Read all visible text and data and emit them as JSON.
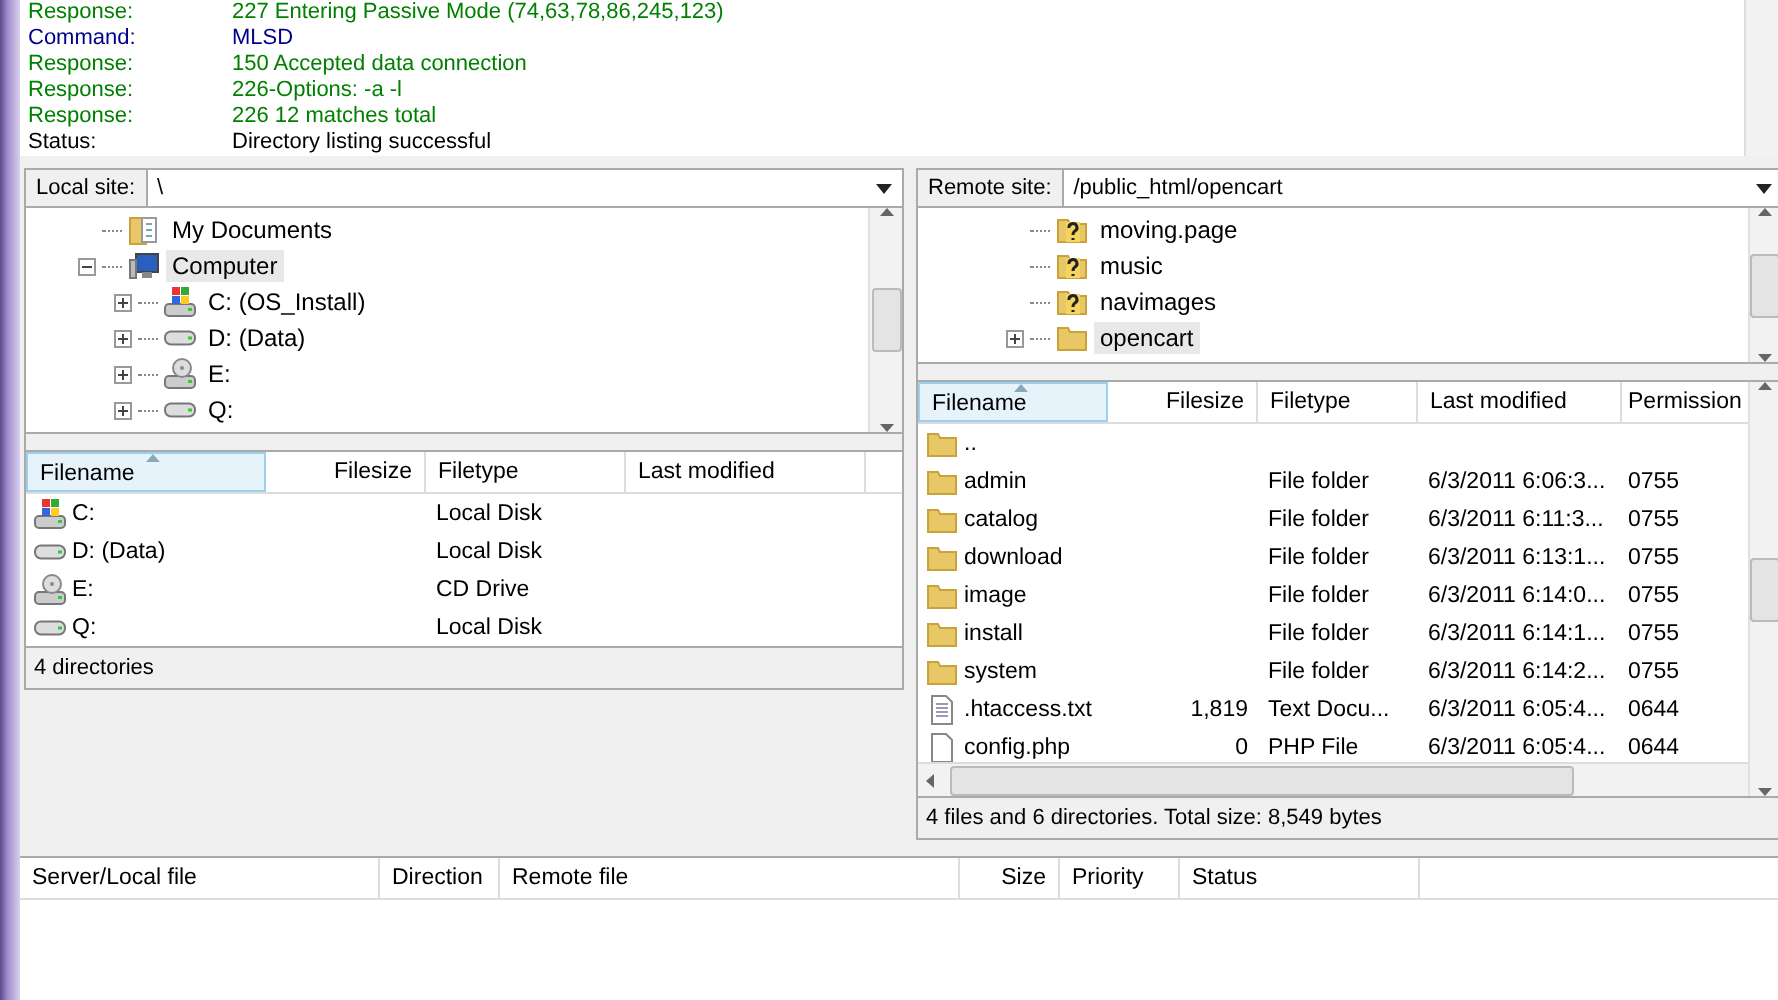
{
  "log": [
    {
      "kind": "response",
      "label": "Response:",
      "text": "227 Entering Passive Mode (74,63,78,86,245,123)"
    },
    {
      "kind": "command",
      "label": "Command:",
      "text": "MLSD"
    },
    {
      "kind": "response",
      "label": "Response:",
      "text": "150 Accepted data connection"
    },
    {
      "kind": "response",
      "label": "Response:",
      "text": "226-Options: -a -l"
    },
    {
      "kind": "response",
      "label": "Response:",
      "text": "226 12 matches total"
    },
    {
      "kind": "status",
      "label": "Status:",
      "text": "Directory listing successful"
    }
  ],
  "local": {
    "site_label": "Local site:",
    "path": "\\",
    "tree": [
      {
        "kind": "documents",
        "label": "My Documents",
        "selected": false
      },
      {
        "kind": "computer",
        "label": "Computer",
        "selected": true,
        "expanded": true,
        "children": [
          {
            "kind": "drive_windows",
            "label": "C: (OS_Install)",
            "selected": false,
            "expanded": false
          },
          {
            "kind": "drive",
            "label": "D: (Data)",
            "selected": false,
            "expanded": false
          },
          {
            "kind": "drive_cd",
            "label": "E:",
            "selected": false,
            "expanded": false
          },
          {
            "kind": "drive",
            "label": "Q:",
            "selected": false,
            "expanded": false
          }
        ]
      }
    ],
    "columns": [
      {
        "label": "Filename",
        "sorted": true
      },
      {
        "label": "Filesize",
        "sorted": false
      },
      {
        "label": "Filetype",
        "sorted": false
      },
      {
        "label": "Last modified",
        "sorted": false
      }
    ],
    "rows": [
      {
        "kind": "drive_windows",
        "name": "C:",
        "type": "Local Disk"
      },
      {
        "kind": "drive",
        "name": "D: (Data)",
        "type": "Local Disk"
      },
      {
        "kind": "drive_cd",
        "name": "E:",
        "type": "CD Drive"
      },
      {
        "kind": "drive",
        "name": "Q:",
        "type": "Local Disk"
      }
    ],
    "status": "4 directories"
  },
  "remote": {
    "site_label": "Remote site:",
    "path": "/public_html/opencart",
    "tree": [
      {
        "kind": "unknown",
        "label": "moving.page",
        "selected": false
      },
      {
        "kind": "unknown",
        "label": "music",
        "selected": false
      },
      {
        "kind": "unknown",
        "label": "navimages",
        "selected": false
      },
      {
        "kind": "folder",
        "label": "opencart",
        "selected": true,
        "expanded": false
      }
    ],
    "columns": [
      {
        "label": "Filename",
        "sorted": true
      },
      {
        "label": "Filesize",
        "sorted": false
      },
      {
        "label": "Filetype",
        "sorted": false
      },
      {
        "label": "Last modified",
        "sorted": false
      },
      {
        "label": "Permission",
        "sorted": false
      }
    ],
    "rows": [
      {
        "kind": "folder",
        "name": ".."
      },
      {
        "kind": "folder",
        "name": "admin",
        "type": "File folder",
        "modified": "6/3/2011 6:06:3...",
        "permissions": "0755"
      },
      {
        "kind": "folder",
        "name": "catalog",
        "type": "File folder",
        "modified": "6/3/2011 6:11:3...",
        "permissions": "0755"
      },
      {
        "kind": "folder",
        "name": "download",
        "type": "File folder",
        "modified": "6/3/2011 6:13:1...",
        "permissions": "0755"
      },
      {
        "kind": "folder",
        "name": "image",
        "type": "File folder",
        "modified": "6/3/2011 6:14:0...",
        "permissions": "0755"
      },
      {
        "kind": "folder",
        "name": "install",
        "type": "File folder",
        "modified": "6/3/2011 6:14:1...",
        "permissions": "0755"
      },
      {
        "kind": "folder",
        "name": "system",
        "type": "File folder",
        "modified": "6/3/2011 6:14:2...",
        "permissions": "0755"
      },
      {
        "kind": "text",
        "name": ".htaccess.txt",
        "size": "1,819",
        "type": "Text Docu...",
        "modified": "6/3/2011 6:05:4...",
        "permissions": "0644"
      },
      {
        "kind": "file",
        "name": "config.php",
        "size": "0",
        "type": "PHP File",
        "modified": "6/3/2011 6:05:4...",
        "permissions": "0644"
      }
    ],
    "status": "4 files and 6 directories. Total size: 8,549 bytes"
  },
  "queue": {
    "columns": [
      {
        "label": "Server/Local file"
      },
      {
        "label": "Direction"
      },
      {
        "label": "Remote file"
      },
      {
        "label": "Size"
      },
      {
        "label": "Priority"
      },
      {
        "label": "Status"
      }
    ]
  }
}
